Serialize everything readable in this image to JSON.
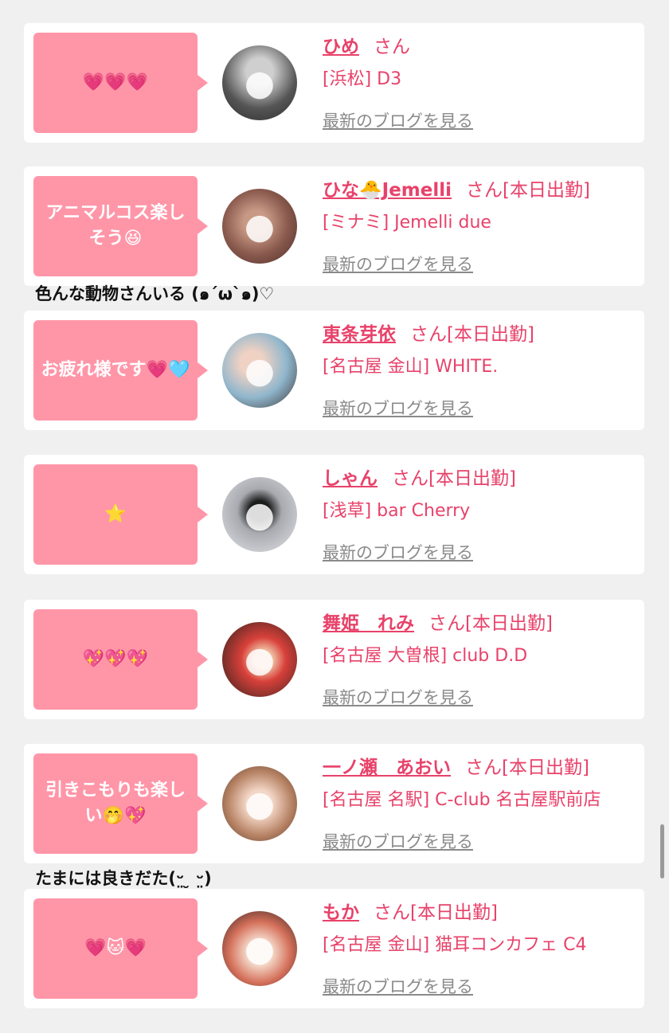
{
  "entries": [
    {
      "bubble": "💗💗💗",
      "name": "ひめ",
      "suffix": "さん",
      "shop": "[浜松] D3",
      "blog": "最新のブログを見る",
      "avatar_color": "#6b6b6b",
      "avatar_icon": "person-photo"
    },
    {
      "bubble": "アニマルコス楽しそう😆",
      "name": "ひな🐣Jemelli",
      "suffix": "さん[本日出勤]",
      "shop": "[ミナミ] Jemelli due",
      "blog": "最新のブログを見る",
      "avatar_color": "#8a5a4e",
      "avatar_icon": "person-photo"
    },
    {
      "bubble": "お疲れ様です💗🩵",
      "name": "東条芽依",
      "suffix": "さん[本日出勤]",
      "shop": "[名古屋 金山] WHITE.",
      "blog": "最新のブログを見る",
      "avatar_color": "#8fb6cc",
      "avatar_icon": "person-photo"
    },
    {
      "bubble": "⭐",
      "name": "しゃん",
      "suffix": "さん[本日出勤]",
      "shop": "[浅草] bar Cherry",
      "blog": "最新のブログを見る",
      "avatar_color": "#cfd1d6",
      "avatar_icon": "person-photo"
    },
    {
      "bubble": "💖💖💖",
      "name": "舞姫　れみ",
      "suffix": "さん[本日出勤]",
      "shop": "[名古屋 大曽根] club D.D",
      "blog": "最新のブログを見る",
      "avatar_color": "#3b2a24",
      "avatar_icon": "person-photo"
    },
    {
      "bubble": "引きこもりも楽しい🤭💖",
      "name": "一ノ瀬　あおい",
      "suffix": "さん[本日出勤]",
      "shop": "[名古屋 名駅] C-club 名古屋駅前店",
      "blog": "最新のブログを見る",
      "avatar_color": "#c9a08a",
      "avatar_icon": "person-photo"
    },
    {
      "bubble": "💗🐱💗",
      "name": "もか",
      "suffix": "さん[本日出勤]",
      "shop": "[名古屋 金山] 猫耳コンカフェ C4",
      "blog": "最新のブログを見る",
      "avatar_color": "#d4705a",
      "avatar_icon": "person-photo"
    }
  ],
  "comments": {
    "after_entry_2": "色んな動物さんいる (๑´ω`๑)♡",
    "after_entry_6": "たまには良きだた(ᵕ̤ ̮ ᵕ̤)"
  },
  "colors": {
    "accent": "#e8426a",
    "bubble": "#ff96a8",
    "background": "#f0f0f0",
    "link_gray": "#8a8a8a"
  }
}
